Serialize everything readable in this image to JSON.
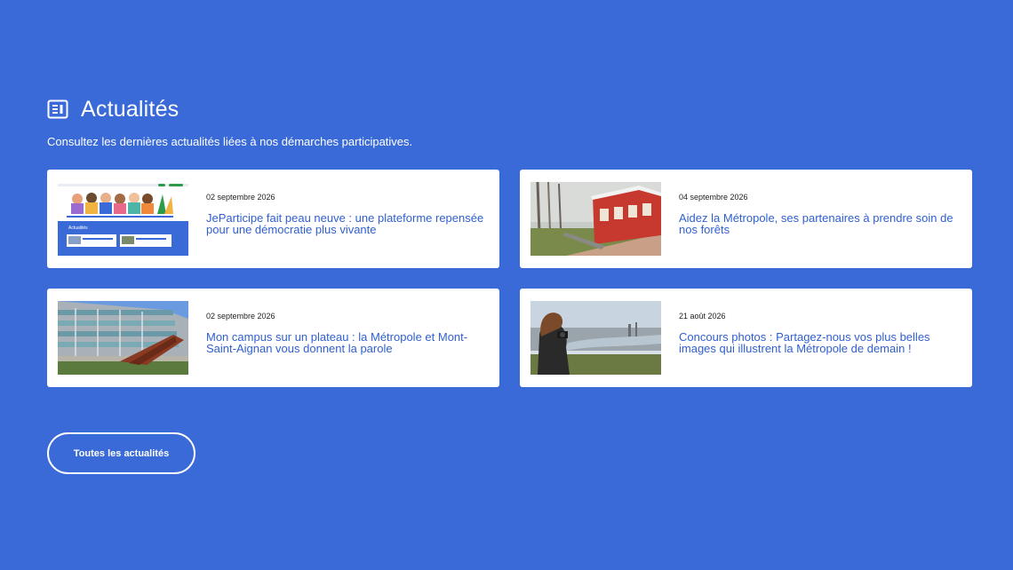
{
  "section": {
    "title": "Actualités",
    "subtitle": "Consultez les dernières actualités liées à nos démarches participatives."
  },
  "cards": [
    {
      "date": "02 septembre 2026",
      "title": "JeParticipe fait peau neuve : une plateforme repensée pour une démocratie plus vivante",
      "thumb_label": "Actualités"
    },
    {
      "date": "04 septembre 2026",
      "title": "Aidez la Métropole, ses partenaires à prendre soin de nos forêts"
    },
    {
      "date": "02 septembre 2026",
      "title": "Mon campus sur un plateau : la Métropole et Mont-Saint-Aignan vous donnent la parole"
    },
    {
      "date": "21 août 2026",
      "title": "Concours photos : Partagez-nous vos plus belles images qui illustrent la Métropole de demain !"
    }
  ],
  "more_button": "Toutes les actualités",
  "colors": {
    "background": "#3a6ad8",
    "link": "#2f5fd0",
    "card": "#ffffff"
  }
}
